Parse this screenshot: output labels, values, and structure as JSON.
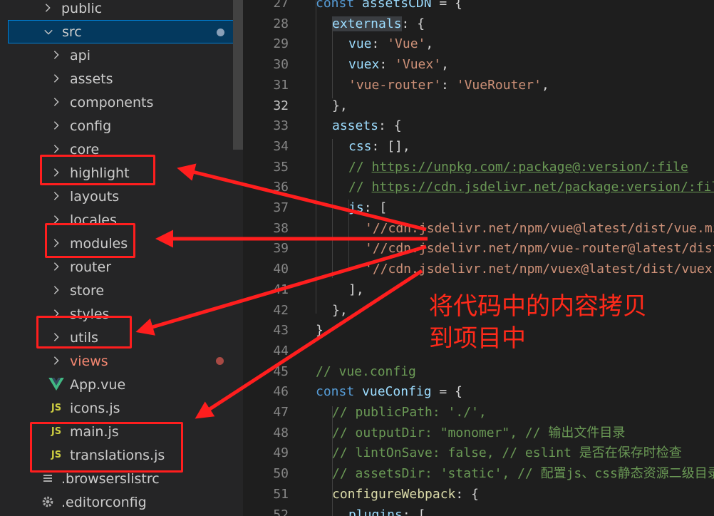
{
  "explorer": {
    "items": [
      {
        "label": "public",
        "kind": "folder",
        "expanded": false
      },
      {
        "label": "src",
        "kind": "folder",
        "expanded": true,
        "selected": true,
        "badge": "modified-dot"
      },
      {
        "label": "api",
        "kind": "folder"
      },
      {
        "label": "assets",
        "kind": "folder"
      },
      {
        "label": "components",
        "kind": "folder"
      },
      {
        "label": "config",
        "kind": "folder"
      },
      {
        "label": "core",
        "kind": "folder"
      },
      {
        "label": "highlight",
        "kind": "folder"
      },
      {
        "label": "layouts",
        "kind": "folder"
      },
      {
        "label": "locales",
        "kind": "folder"
      },
      {
        "label": "modules",
        "kind": "folder"
      },
      {
        "label": "router",
        "kind": "folder"
      },
      {
        "label": "store",
        "kind": "folder"
      },
      {
        "label": "styles",
        "kind": "folder"
      },
      {
        "label": "utils",
        "kind": "folder"
      },
      {
        "label": "views",
        "kind": "folder",
        "badge": "error-dot"
      },
      {
        "label": "App.vue",
        "kind": "vue-file",
        "icon": "vue-icon"
      },
      {
        "label": "icons.js",
        "kind": "js-file",
        "icon_text": "JS"
      },
      {
        "label": "main.js",
        "kind": "js-file",
        "icon_text": "JS"
      },
      {
        "label": "translations.js",
        "kind": "js-file",
        "icon_text": "JS"
      },
      {
        "label": ".browserslistrc",
        "kind": "file",
        "icon": "lines-icon"
      },
      {
        "label": ".editorconfig",
        "kind": "file",
        "icon": "gear-icon"
      }
    ]
  },
  "editor": {
    "active_line": "32",
    "lines": [
      {
        "n": "27",
        "tokens": [
          [
            "k",
            "const "
          ],
          [
            "v",
            "assetsCDN"
          ],
          [
            "p",
            " = {"
          ]
        ]
      },
      {
        "n": "28",
        "tokens": [
          [
            "v",
            "externals"
          ],
          [
            "p",
            ": {"
          ]
        ]
      },
      {
        "n": "29",
        "tokens": [
          [
            "v",
            "vue"
          ],
          [
            "p",
            ": "
          ],
          [
            "s",
            "'Vue'"
          ],
          [
            "p",
            ","
          ]
        ]
      },
      {
        "n": "30",
        "tokens": [
          [
            "v",
            "vuex"
          ],
          [
            "p",
            ": "
          ],
          [
            "s",
            "'Vuex'"
          ],
          [
            "p",
            ","
          ]
        ]
      },
      {
        "n": "31",
        "tokens": [
          [
            "s",
            "'vue-router'"
          ],
          [
            "p",
            ": "
          ],
          [
            "s",
            "'VueRouter'"
          ],
          [
            "p",
            ","
          ]
        ]
      },
      {
        "n": "32",
        "tokens": [
          [
            "p",
            "},"
          ]
        ]
      },
      {
        "n": "33",
        "tokens": [
          [
            "v",
            "assets"
          ],
          [
            "p",
            ": {"
          ]
        ]
      },
      {
        "n": "34",
        "tokens": [
          [
            "v",
            "css"
          ],
          [
            "p",
            ": [],"
          ]
        ]
      },
      {
        "n": "35",
        "tokens": [
          [
            "c",
            "// "
          ],
          [
            "cu",
            "https://unpkg.com/:package@:version/:file"
          ]
        ]
      },
      {
        "n": "36",
        "tokens": [
          [
            "c",
            "// "
          ],
          [
            "cu",
            "https://cdn.jsdelivr.net/package:version/:file"
          ]
        ]
      },
      {
        "n": "37",
        "tokens": [
          [
            "v",
            "js"
          ],
          [
            "p",
            ": ["
          ]
        ]
      },
      {
        "n": "38",
        "tokens": [
          [
            "s",
            "'//cdn.jsdelivr.net/npm/vue@latest/dist/vue.min.js'"
          ],
          [
            "p",
            ","
          ]
        ]
      },
      {
        "n": "39",
        "tokens": [
          [
            "s",
            "'//cdn.jsdelivr.net/npm/vue-router@latest/dist/vue-router.min.js'"
          ],
          [
            "p",
            ","
          ]
        ]
      },
      {
        "n": "40",
        "tokens": [
          [
            "s",
            "'//cdn.jsdelivr.net/npm/vuex@latest/dist/vuex.min.js'"
          ]
        ]
      },
      {
        "n": "41",
        "tokens": [
          [
            "p",
            "],"
          ]
        ]
      },
      {
        "n": "42",
        "tokens": [
          [
            "p",
            "},"
          ]
        ]
      },
      {
        "n": "43",
        "tokens": [
          [
            "p",
            "}"
          ]
        ]
      },
      {
        "n": "44",
        "tokens": []
      },
      {
        "n": "45",
        "tokens": [
          [
            "c",
            "// vue.config"
          ]
        ]
      },
      {
        "n": "46",
        "tokens": [
          [
            "k",
            "const "
          ],
          [
            "v",
            "vueConfig"
          ],
          [
            "p",
            " = {"
          ]
        ]
      },
      {
        "n": "47",
        "tokens": [
          [
            "c",
            "// publicPath: './',"
          ]
        ]
      },
      {
        "n": "48",
        "tokens": [
          [
            "c",
            "// outputDir: \"monomer\", // 输出文件目录"
          ]
        ]
      },
      {
        "n": "49",
        "tokens": [
          [
            "c",
            "// lintOnSave: false, // eslint 是否在保存时检查"
          ]
        ]
      },
      {
        "n": "50",
        "tokens": [
          [
            "c",
            "// assetsDir: 'static', // 配置js、css静态资源二级目录"
          ]
        ]
      },
      {
        "n": "51",
        "tokens": [
          [
            "f",
            "configureWebpack"
          ],
          [
            "p",
            ": {"
          ]
        ]
      },
      {
        "n": "52",
        "tokens": [
          [
            "v",
            "plugins"
          ],
          [
            "p",
            ": ["
          ]
        ]
      }
    ]
  },
  "annotation": {
    "line1": "将代码中的内容拷贝",
    "line2": "到项目中"
  },
  "colors": {
    "highlight_box": "#ff1e1e",
    "annotation_text": "#ff2a1a",
    "selection_bg": "#04395e",
    "selection_border": "#007fd4"
  }
}
